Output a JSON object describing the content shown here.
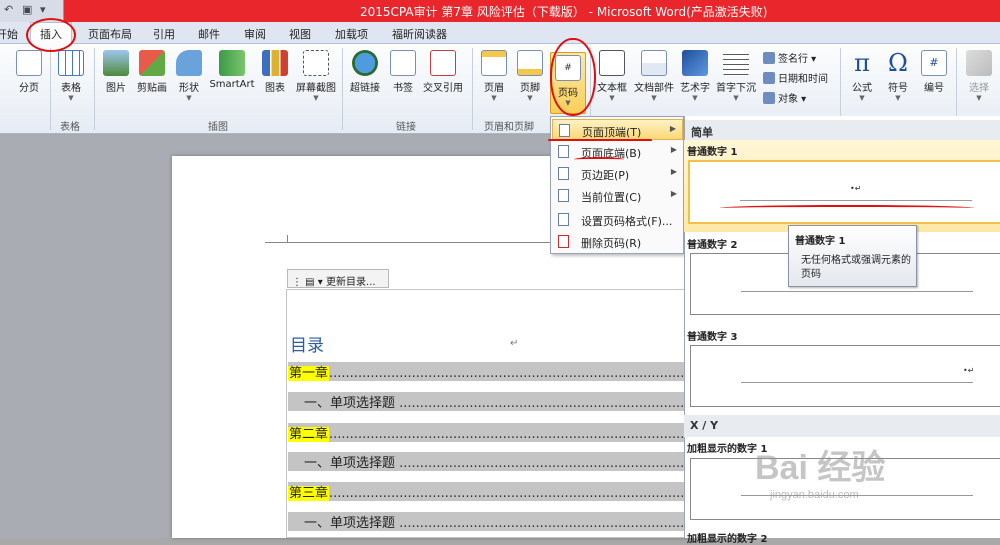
{
  "window": {
    "title": "2015CPA审计 第7章 风险评估（下载版） - Microsoft Word(产品激活失败)"
  },
  "tabs": [
    {
      "label": "开始"
    },
    {
      "label": "插入"
    },
    {
      "label": "页面布局"
    },
    {
      "label": "引用"
    },
    {
      "label": "邮件"
    },
    {
      "label": "审阅"
    },
    {
      "label": "视图"
    },
    {
      "label": "加载项"
    },
    {
      "label": "福昕阅读器"
    }
  ],
  "ribbon": {
    "groups": [
      "表格",
      "插图",
      "链接",
      "页眉和页脚"
    ],
    "buttons": {
      "page_break": "分页",
      "table": "表格",
      "picture": "图片",
      "clipart": "剪贴画",
      "shapes": "形状",
      "smartart": "SmartArt",
      "chart": "图表",
      "screenshot": "屏幕截图",
      "hyperlink": "超链接",
      "bookmark": "书签",
      "crossref": "交叉引用",
      "header": "页眉",
      "footer": "页脚",
      "page_number": "页码",
      "textbox": "文本框",
      "quickparts": "文档部件",
      "wordart": "艺术字",
      "dropcap": "首字下沉",
      "signature": "签名行",
      "datetime": "日期和时间",
      "object": "对象",
      "equation": "公式",
      "symbol": "符号",
      "number": "编号",
      "select": "选择"
    },
    "glyphs": {
      "pi": "π",
      "omega": "Ω",
      "hash": "#"
    }
  },
  "dropdown_menu": {
    "items": [
      {
        "label": "页面顶端(T)"
      },
      {
        "label": "页面底端(B)"
      },
      {
        "label": "页边距(P)"
      },
      {
        "label": "当前位置(C)"
      },
      {
        "label": "设置页码格式(F)..."
      },
      {
        "label": "删除页码(R)"
      }
    ]
  },
  "gallery": {
    "section_simple": "简单",
    "section_xy": "X / Y",
    "items": [
      {
        "label": "普通数字 1"
      },
      {
        "label": "普通数字 2"
      },
      {
        "label": "普通数字 3"
      },
      {
        "label": "加粗显示的数字 1"
      }
    ],
    "bottom_partial": "加粗显示的数字 2"
  },
  "tooltip": {
    "title": "普通数字 1",
    "description": "无任何格式或强调元素的页码"
  },
  "document": {
    "toc_toolbar": "更新目录...",
    "toc_title": "目录",
    "para_mark": "↵",
    "rows": [
      {
        "chapter": "第一章"
      },
      {
        "text": "一、单项选择题"
      },
      {
        "chapter": "第二章"
      },
      {
        "text": "一、单项选择题"
      },
      {
        "chapter": "第三章"
      },
      {
        "text": "一、单项选择题"
      }
    ]
  },
  "watermark": {
    "text": "Bai 经验",
    "sub": "jingyan.baidu.com"
  },
  "colors": {
    "title_bar": "#e9262b",
    "accent_highlight": "#fbd878",
    "annotation_red": "#e01010",
    "toc_highlight": "#ffff00"
  }
}
